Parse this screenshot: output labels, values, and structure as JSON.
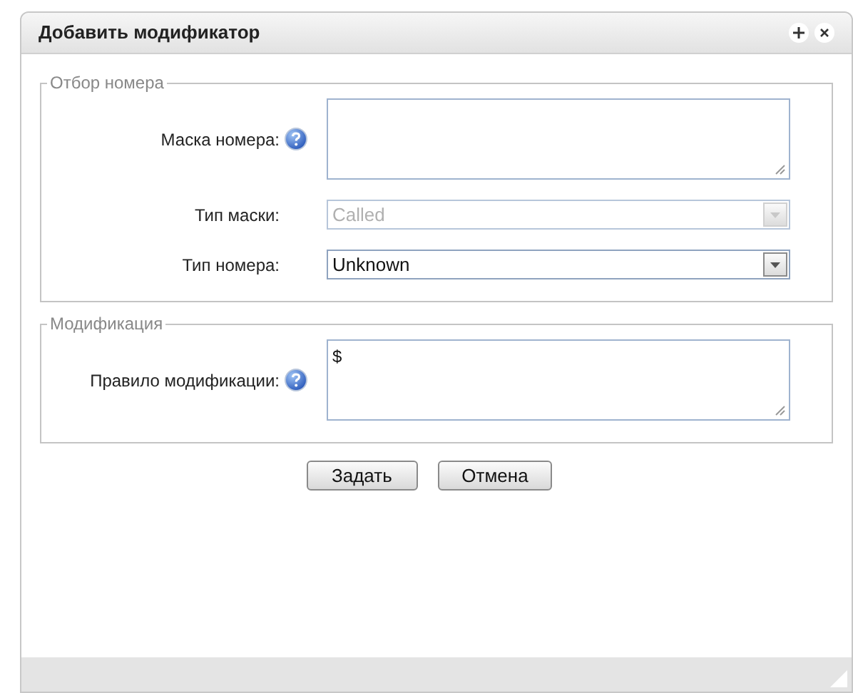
{
  "dialog": {
    "title": "Добавить модификатор"
  },
  "sections": [
    {
      "legend": "Отбор номера",
      "fields": [
        {
          "kind": "textarea",
          "label": "Маска номера:",
          "help": true
        },
        {
          "kind": "select",
          "label": "Тип маски:",
          "help": false,
          "value": "Called",
          "disabled": true
        },
        {
          "kind": "select",
          "label": "Тип номера:",
          "help": false,
          "value": "Unknown",
          "disabled": false
        }
      ]
    },
    {
      "legend": "Модификация",
      "fields": [
        {
          "kind": "textarea",
          "label": "Правило модификации:",
          "help": true,
          "value": "$"
        }
      ]
    }
  ],
  "buttons": [
    "Задать",
    "Отмена"
  ]
}
